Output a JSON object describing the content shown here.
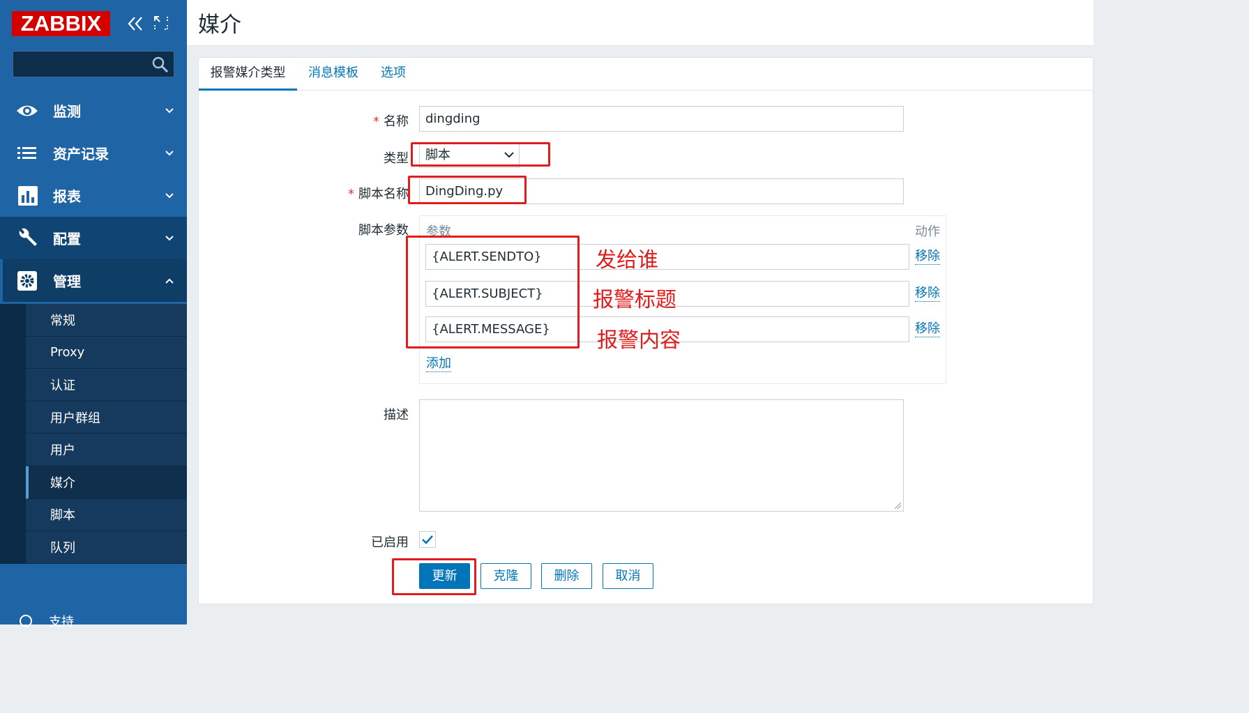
{
  "sidebar": {
    "logo": "ZABBIX",
    "menu": [
      {
        "label": "监测",
        "icon": "eye-icon"
      },
      {
        "label": "资产记录",
        "icon": "list-icon"
      },
      {
        "label": "报表",
        "icon": "bar-chart-icon"
      },
      {
        "label": "配置",
        "icon": "wrench-icon"
      },
      {
        "label": "管理",
        "icon": "gear-icon"
      }
    ],
    "submenu": [
      "常规",
      "Proxy",
      "认证",
      "用户群组",
      "用户",
      "媒介",
      "脚本",
      "队列"
    ],
    "support": "支持"
  },
  "header": {
    "title": "媒介"
  },
  "tabs": [
    "报警媒介类型",
    "消息模板",
    "选项"
  ],
  "form": {
    "name_label": "名称",
    "name_value": "dingding",
    "type_label": "类型",
    "type_value": "脚本",
    "script_name_label": "脚本名称",
    "script_name_value": "DingDing.py",
    "script_params_label": "脚本参数",
    "params_header": "参数",
    "action_header": "动作",
    "params": [
      {
        "value": "{ALERT.SENDTO}",
        "remove": "移除"
      },
      {
        "value": "{ALERT.SUBJECT}",
        "remove": "移除"
      },
      {
        "value": "{ALERT.MESSAGE}",
        "remove": "移除"
      }
    ],
    "add_link": "添加",
    "description_label": "描述",
    "enabled_label": "已启用"
  },
  "buttons": {
    "update": "更新",
    "clone": "克隆",
    "delete": "删除",
    "cancel": "取消"
  },
  "annotations": [
    "发给谁",
    "报警标题",
    "报警内容"
  ],
  "colors": {
    "sidebar": "#1f65a6",
    "brand": "#d40000",
    "accent": "#0275b8",
    "annotation": "#e21c1c"
  }
}
